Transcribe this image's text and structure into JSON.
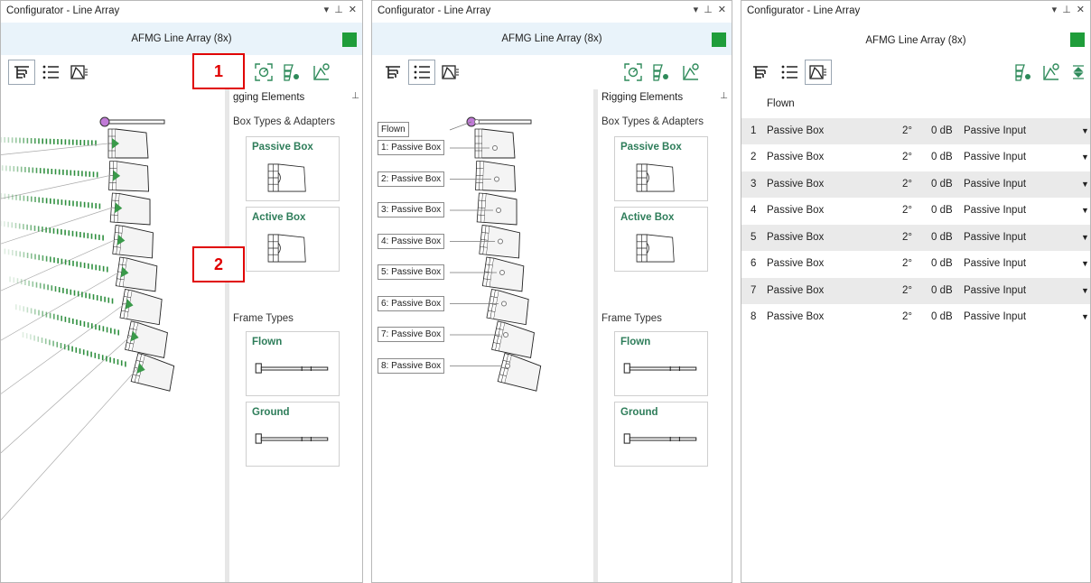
{
  "panels": [
    {
      "title": "Configurator - Line Array",
      "array_name": "AFMG Line Array (8x)",
      "side_header": "gging Elements",
      "box_types_label": "Box Types & Adapters",
      "passive_box": "Passive Box",
      "active_box": "Active Box",
      "frame_types_label": "Frame Types",
      "flown": "Flown",
      "ground": "Ground"
    },
    {
      "title": "Configurator - Line Array",
      "array_name": "AFMG Line Array (8x)",
      "side_header": "Rigging Elements",
      "box_types_label": "Box Types & Adapters",
      "passive_box": "Passive Box",
      "active_box": "Active Box",
      "frame_types_label": "Frame Types",
      "flown": "Flown",
      "ground": "Ground",
      "diagram_labels": [
        "Flown",
        "1: Passive Box",
        "2: Passive Box",
        "3: Passive Box",
        "4: Passive Box",
        "5: Passive Box",
        "6: Passive Box",
        "7: Passive Box",
        "8: Passive Box"
      ]
    },
    {
      "title": "Configurator - Line Array",
      "array_name": "AFMG Line Array (8x)",
      "table_header": "Flown",
      "rows": [
        {
          "n": "1",
          "type": "Passive Box",
          "angle": "2°",
          "gain": "0 dB",
          "input": "Passive Input"
        },
        {
          "n": "2",
          "type": "Passive Box",
          "angle": "2°",
          "gain": "0 dB",
          "input": "Passive Input"
        },
        {
          "n": "3",
          "type": "Passive Box",
          "angle": "2°",
          "gain": "0 dB",
          "input": "Passive Input"
        },
        {
          "n": "4",
          "type": "Passive Box",
          "angle": "2°",
          "gain": "0 dB",
          "input": "Passive Input"
        },
        {
          "n": "5",
          "type": "Passive Box",
          "angle": "2°",
          "gain": "0 dB",
          "input": "Passive Input"
        },
        {
          "n": "6",
          "type": "Passive Box",
          "angle": "2°",
          "gain": "0 dB",
          "input": "Passive Input"
        },
        {
          "n": "7",
          "type": "Passive Box",
          "angle": "2°",
          "gain": "0 dB",
          "input": "Passive Input"
        },
        {
          "n": "8",
          "type": "Passive Box",
          "angle": "2°",
          "gain": "0 dB",
          "input": "Passive Input"
        }
      ]
    }
  ],
  "window_controls": {
    "dropdown": "▾",
    "pin": "⊥",
    "close": "✕"
  },
  "callouts": [
    "1",
    "2"
  ],
  "colors": {
    "accent_green": "#1f9d3a",
    "title_green": "#2e7d5a",
    "callout_red": "#e00000",
    "header_blue": "#e9f3fa"
  }
}
